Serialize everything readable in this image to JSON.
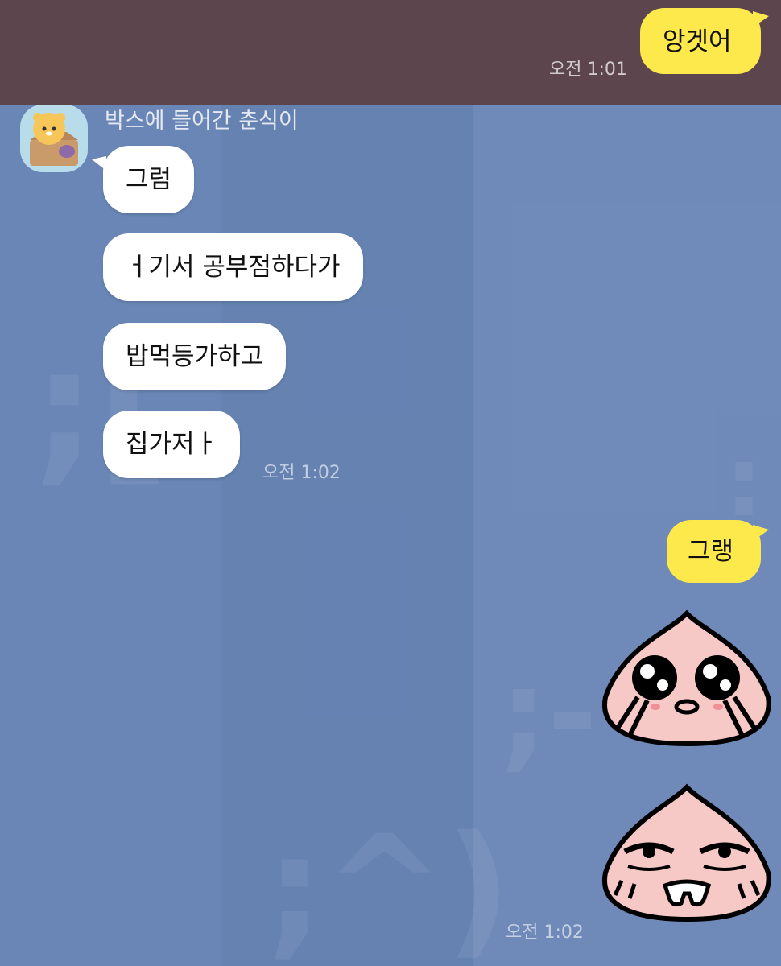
{
  "chat": {
    "top_message": {
      "text": "앙겟어",
      "time": "오전 1:01"
    },
    "sender": {
      "name": "박스에 들어간 춘식이",
      "avatar_icon": "chunsik-in-box-avatar-icon"
    },
    "incoming_messages": [
      {
        "text": "그럼"
      },
      {
        "text": "ㅓ기서 공부점하다가"
      },
      {
        "text": "밥먹등가하고"
      },
      {
        "text": "집가저ㅏ"
      }
    ],
    "incoming_time": "오전 1:02",
    "reply_message": {
      "text": "그랭"
    },
    "emoticons": [
      {
        "icon": "apeach-crying-emoticon"
      },
      {
        "icon": "apeach-drooling-emoticon"
      }
    ],
    "reply_time": "오전 1:02"
  },
  "colors": {
    "chat_background": "#6a86b6",
    "top_band": "#5c454c",
    "outgoing_bubble": "#fde94b",
    "incoming_bubble": "#ffffff"
  }
}
